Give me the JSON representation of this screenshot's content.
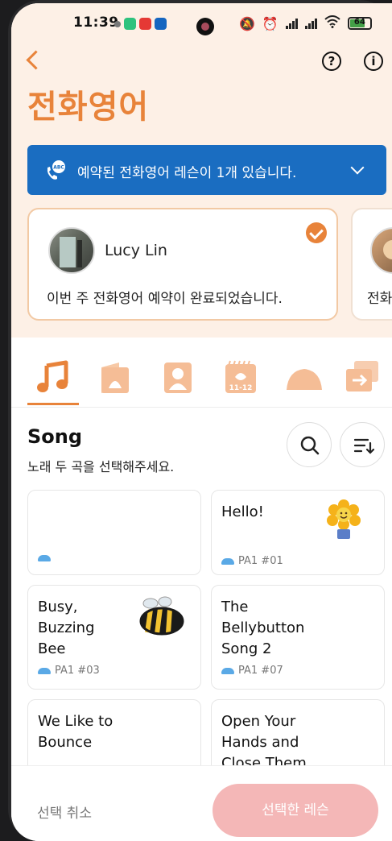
{
  "status": {
    "time": "11:39",
    "battery": "64"
  },
  "header": {
    "title": "전화영어"
  },
  "banner": {
    "text": "예약된 전화영어 레슨이 1개 있습니다.",
    "icon_label": "ABC"
  },
  "tutor_cards": [
    {
      "name": "Lucy Lin",
      "message": "이번 주 전화영어 예약이 완료되었습니다."
    },
    {
      "name": "",
      "message": "전화"
    }
  ],
  "category_tabs": [
    {
      "icon": "music-note-icon",
      "selected": true
    },
    {
      "icon": "book-icon",
      "selected": false
    },
    {
      "icon": "picture-book-icon",
      "selected": false
    },
    {
      "icon": "calendar-icon",
      "selected": false
    },
    {
      "icon": "cloud-icon",
      "selected": false
    },
    {
      "icon": "cards-icon",
      "selected": false
    }
  ],
  "section": {
    "title": "Song",
    "subtitle": "노래 두 곡을 선택해주세요."
  },
  "songs": [
    {
      "title": "",
      "code": ""
    },
    {
      "title": "Hello!",
      "code": "PA1 #01"
    },
    {
      "title": "Busy, Buzzing Bee",
      "code": "PA1 #03"
    },
    {
      "title": "The Bellybutton Song 2",
      "code": "PA1 #07"
    },
    {
      "title": "We Like to Bounce",
      "code": ""
    },
    {
      "title": "Open Your Hands and Close Them",
      "code": ""
    }
  ],
  "bottom": {
    "cancel_label": "선택 취소",
    "select_label": "선택한 레슨"
  },
  "colors": {
    "accent": "#e8833a",
    "banner": "#1a6dc1",
    "header_bg": "#fdf0e6",
    "select_button": "#f4b7b7"
  }
}
